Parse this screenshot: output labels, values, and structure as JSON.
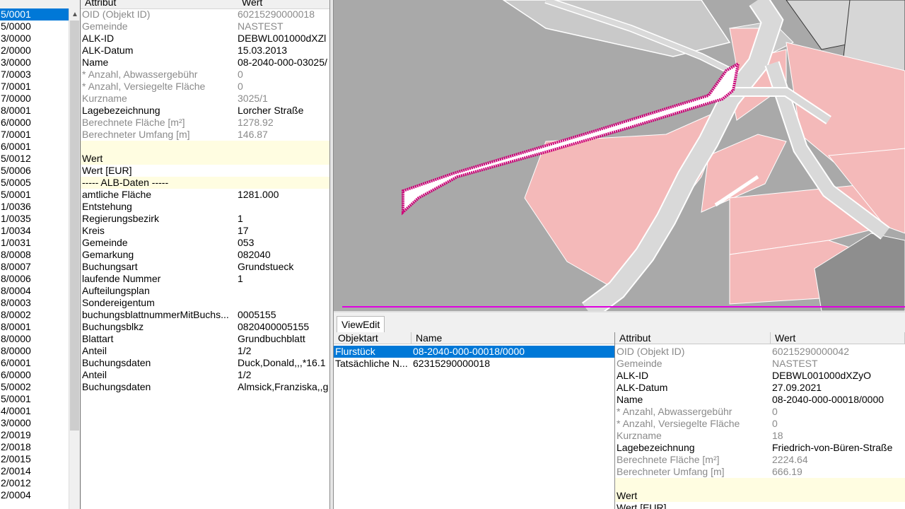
{
  "left_list": {
    "items": [
      "5/0001",
      "5/0000",
      "3/0000",
      "2/0000",
      "3/0000",
      "7/0003",
      "7/0001",
      "7/0000",
      "8/0001",
      "6/0000",
      "7/0001",
      "6/0001",
      "5/0012",
      "5/0006",
      "5/0005",
      "5/0001",
      "1/0036",
      "1/0035",
      "1/0034",
      "1/0031",
      "8/0008",
      "8/0007",
      "8/0006",
      "8/0004",
      "8/0003",
      "8/0002",
      "8/0001",
      "8/0000",
      "8/0000",
      "6/0001",
      "6/0000",
      "5/0002",
      "5/0001",
      "4/0001",
      "3/0000",
      "2/0019",
      "2/0018",
      "2/0015",
      "2/0014",
      "2/0012",
      "2/0004"
    ],
    "scroll_up_glyph": "▲"
  },
  "attr_table": {
    "col_attr": "Attribut",
    "col_wert": "Wert",
    "rows": [
      {
        "k": "OID (Objekt ID)",
        "v": "60215290000018",
        "style": "g"
      },
      {
        "k": "Gemeinde",
        "v": "NASTEST",
        "style": "g"
      },
      {
        "k": "ALK-ID",
        "v": "DEBWL001000dXZl",
        "style": ""
      },
      {
        "k": "ALK-Datum",
        "v": "15.03.2013",
        "style": ""
      },
      {
        "k": "Name",
        "v": "08-2040-000-03025/",
        "style": ""
      },
      {
        "k": "* Anzahl, Abwassergebühr",
        "v": "0",
        "style": "g"
      },
      {
        "k": "* Anzahl, Versiegelte Fläche",
        "v": "0",
        "style": "g"
      },
      {
        "k": "Kurzname",
        "v": "3025/1",
        "style": "g"
      },
      {
        "k": "Lagebezeichnung",
        "v": "Lorcher Straße",
        "style": ""
      },
      {
        "k": "Berechnete Fläche [m²]",
        "v": "1278.92",
        "style": "g"
      },
      {
        "k": "Berechneter Umfang [m]",
        "v": "146.87",
        "style": "g"
      },
      {
        "k": "",
        "v": "",
        "style": "hl"
      },
      {
        "k": "Wert",
        "v": "",
        "style": "hl"
      },
      {
        "k": "Wert [EUR]",
        "v": "",
        "style": ""
      },
      {
        "k": "----- ALB-Daten -----",
        "v": "",
        "style": "hl"
      },
      {
        "k": "amtliche Fläche",
        "v": "1281.000",
        "style": ""
      },
      {
        "k": "Entstehung",
        "v": "",
        "style": ""
      },
      {
        "k": "Regierungsbezirk",
        "v": "1",
        "style": ""
      },
      {
        "k": "Kreis",
        "v": "17",
        "style": ""
      },
      {
        "k": "Gemeinde",
        "v": "053",
        "style": ""
      },
      {
        "k": "Gemarkung",
        "v": "082040",
        "style": ""
      },
      {
        "k": "Buchungsart",
        "v": "Grundstueck",
        "style": ""
      },
      {
        "k": "laufende Nummer",
        "v": "1",
        "style": ""
      },
      {
        "k": "Aufteilungsplan",
        "v": "",
        "style": ""
      },
      {
        "k": "Sondereigentum",
        "v": "",
        "style": ""
      },
      {
        "k": "buchungsblattnummerMitBuchs...",
        "v": "0005155",
        "style": ""
      },
      {
        "k": "Buchungsblkz",
        "v": "0820400005155",
        "style": ""
      },
      {
        "k": "Blattart",
        "v": "Grundbuchblatt",
        "style": ""
      },
      {
        "k": "Anteil",
        "v": "1/2",
        "style": ""
      },
      {
        "k": "Buchungsdaten",
        "v": "Duck,Donald,,,*16.1",
        "style": ""
      },
      {
        "k": "Anteil",
        "v": "1/2",
        "style": ""
      },
      {
        "k": "Buchungsdaten",
        "v": "Almsick,Franziska,,g",
        "style": ""
      }
    ]
  },
  "tabs": [
    {
      "label": "ViewEdit"
    }
  ],
  "object_table": {
    "col_objektart": "Objektart",
    "col_name": "Name",
    "rows": [
      {
        "c1": "Flurstück",
        "c2": "08-2040-000-00018/0000",
        "selected": true
      },
      {
        "c1": "Tatsächliche N...",
        "c2": "62315290000018",
        "selected": false
      }
    ]
  },
  "attr_table2": {
    "col_attr": "Attribut",
    "col_wert": "Wert",
    "rows": [
      {
        "k": "OID (Objekt ID)",
        "v": "60215290000042",
        "style": "g"
      },
      {
        "k": "Gemeinde",
        "v": "NASTEST",
        "style": "g"
      },
      {
        "k": "ALK-ID",
        "v": "DEBWL001000dXZyO",
        "style": ""
      },
      {
        "k": "ALK-Datum",
        "v": "27.09.2021",
        "style": ""
      },
      {
        "k": "Name",
        "v": "08-2040-000-00018/0000",
        "style": ""
      },
      {
        "k": "* Anzahl, Abwassergebühr",
        "v": "0",
        "style": "g"
      },
      {
        "k": "* Anzahl, Versiegelte Fläche",
        "v": "0",
        "style": "g"
      },
      {
        "k": "Kurzname",
        "v": "18",
        "style": "g"
      },
      {
        "k": "Lagebezeichnung",
        "v": "Friedrich-von-Büren-Straße",
        "style": ""
      },
      {
        "k": "Berechnete Fläche [m²]",
        "v": "2224.64",
        "style": "g"
      },
      {
        "k": "Berechneter Umfang [m]",
        "v": "666.19",
        "style": "g"
      },
      {
        "k": "",
        "v": "",
        "style": "hl"
      },
      {
        "k": "Wert",
        "v": "",
        "style": "hl"
      },
      {
        "k": "Wert [EUR]",
        "v": "",
        "style": ""
      }
    ]
  },
  "colors": {
    "selection": "#0078d7",
    "highlight_row": "#fffde1",
    "map_background": "#a9a9a9",
    "parcel_fill": "#f4b9b9",
    "road_fill": "#d9d9d9",
    "road_edge": "#ffffff",
    "selected_parcel_outline": "#cc0077",
    "measure_line": "#e000e0"
  }
}
